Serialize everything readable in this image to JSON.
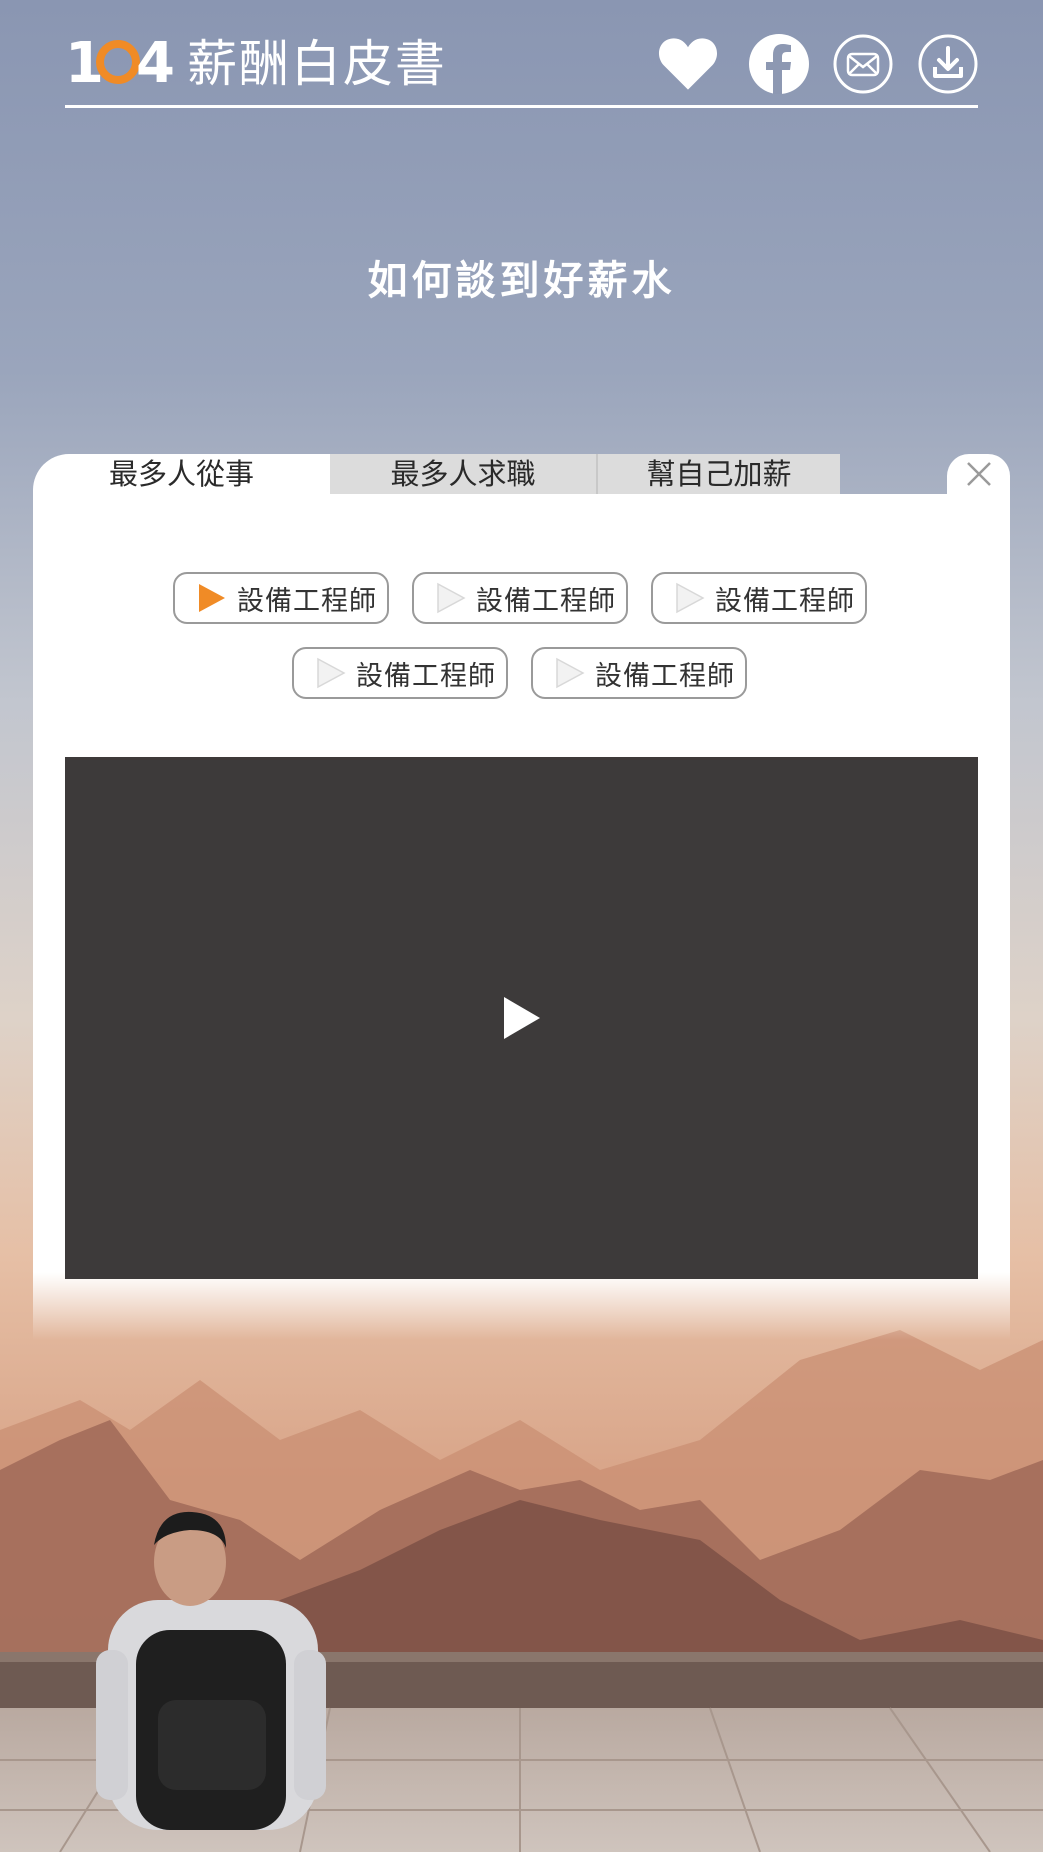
{
  "header": {
    "logo_number": "1",
    "logo_number_end": "4",
    "logo_text": "薪酬白皮書",
    "icons": [
      "heart-icon",
      "facebook-icon",
      "mail-icon",
      "download-icon"
    ]
  },
  "page_title": "如何談到好薪水",
  "tabs": [
    {
      "label": "最多人從事",
      "active": true
    },
    {
      "label": "最多人求職",
      "active": false
    },
    {
      "label": "幫自己加薪",
      "active": false
    }
  ],
  "jobs": [
    {
      "label": "設備工程師",
      "active": true
    },
    {
      "label": "設備工程師",
      "active": false
    },
    {
      "label": "設備工程師",
      "active": false
    },
    {
      "label": "設備工程師",
      "active": false
    },
    {
      "label": "設備工程師",
      "active": false
    }
  ],
  "colors": {
    "accent": "#f08b26",
    "video_bg": "#3d3a3a"
  }
}
